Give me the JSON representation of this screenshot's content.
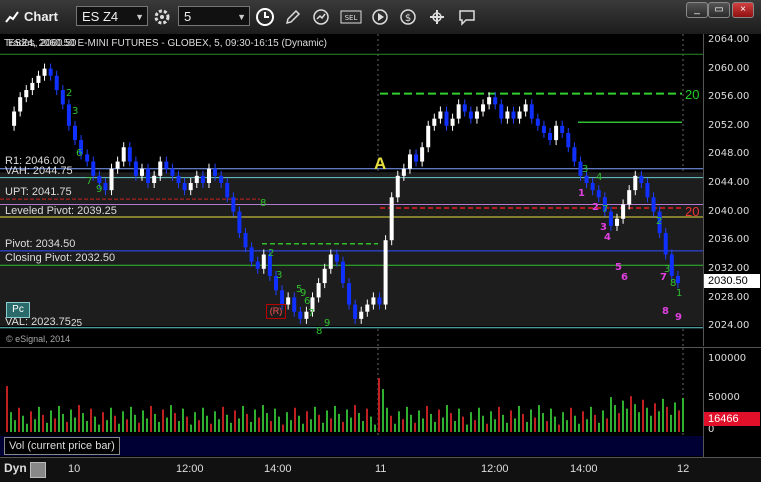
{
  "window": {
    "title": "Chart"
  },
  "toolbar": {
    "symbol": "ES Z4",
    "interval": "5",
    "mode_button": "SEL"
  },
  "chart": {
    "header": "ESZ4, 2060.50 E-MINI FUTURES - GLOBEX, 5, 09:30-16:15 (Dynamic)",
    "header_overlap": "Trades, 2060.50",
    "copyright": "© eSignal, 2014",
    "levels": {
      "r1": "R1: 2046.00",
      "vah": "VAH: 2044.75",
      "upt": "UPT: 2041.75",
      "leveled_pivot": "Leveled Pivot: 2039.25",
      "pivot": "Pivot: 2034.50",
      "closing_pivot": "Closing Pivot: 2032.50",
      "val": "VAL: 2023.75"
    },
    "pc_badge": "Pc",
    "val_tag": "25",
    "marker_a": "A",
    "marker_r": "(R)",
    "right_20_green": "20",
    "right_20_red": "20",
    "last_price": "2030.50",
    "accent_up": "#1030ff",
    "accent_down": "#ffffff"
  },
  "price_axis": [
    "2064.00",
    "2060.00",
    "2056.00",
    "2052.00",
    "2048.00",
    "2044.00",
    "2040.00",
    "2036.00",
    "2032.00",
    "2028.00",
    "2024.00"
  ],
  "volume": {
    "label": "Vol (current price bar)",
    "axis": [
      "100000",
      "50000",
      "0"
    ],
    "current": "16466"
  },
  "time_axis": [
    "10",
    "12:00",
    "14:00",
    "11",
    "12:00",
    "14:00",
    "12"
  ],
  "footer": {
    "dyn": "Dyn"
  },
  "counts": {
    "green": [
      "2",
      "3",
      "6",
      "7",
      "9",
      "8",
      "2",
      "3",
      "5",
      "9",
      "6",
      "7",
      "8",
      "9",
      "3",
      "4",
      "7",
      "2",
      "3",
      "8",
      "1"
    ],
    "magenta": [
      "1",
      "2",
      "3",
      "4",
      "5",
      "6",
      "7",
      "8",
      "9"
    ]
  }
}
